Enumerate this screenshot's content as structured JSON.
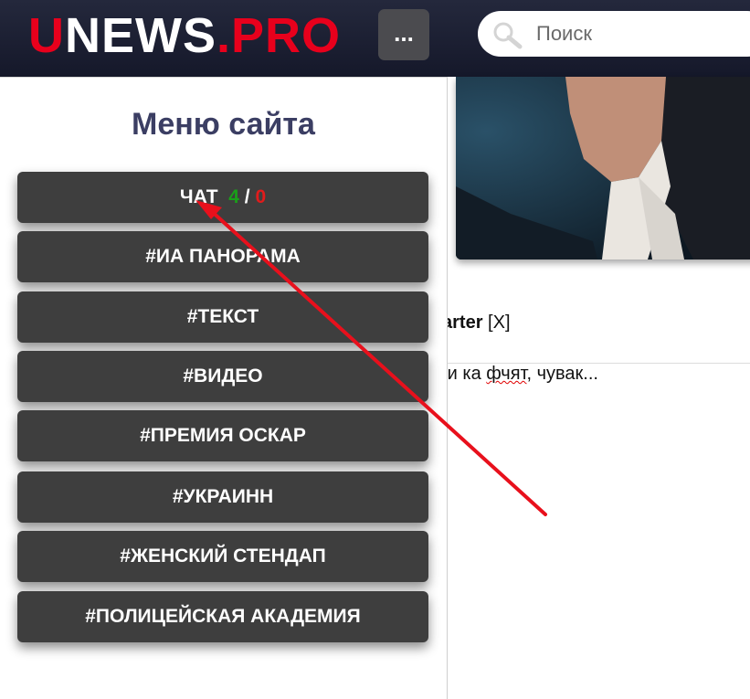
{
  "header": {
    "logo_first": "U",
    "logo_mid": "NEWS",
    "logo_dot": ".",
    "logo_last": "PRO",
    "menu_button_label": "...",
    "search_placeholder": "Поиск"
  },
  "sidebar": {
    "title": "Меню сайта",
    "chat": {
      "label": "ЧАТ",
      "online": "4",
      "separator": "/",
      "unread": "0"
    },
    "items": [
      {
        "label": "#ИА ПАНОРАМА"
      },
      {
        "label": "#ТЕКСТ"
      },
      {
        "label": "#ВИДЕО"
      },
      {
        "label": "#ПРЕМИЯ ОСКАР"
      },
      {
        "label": "#УКРАИНН"
      },
      {
        "label": "#ЖЕНСКИЙ СТЕНДАП"
      },
      {
        "label": "#ПОЛИЦЕЙСКАЯ АКАДЕМИЯ"
      }
    ]
  },
  "content": {
    "comment_author": "arter",
    "comment_close": "[X]",
    "comment_text_pre": "ди ка ",
    "comment_text_misspelled": "фчят",
    "comment_text_post": ", чувак..."
  },
  "colors": {
    "brand_red": "#e8001c",
    "header_bg": "#1c2033",
    "menu_item_bg": "#3e3e3e",
    "title_color": "#3b3e63",
    "annotation_arrow": "#e8101c"
  }
}
